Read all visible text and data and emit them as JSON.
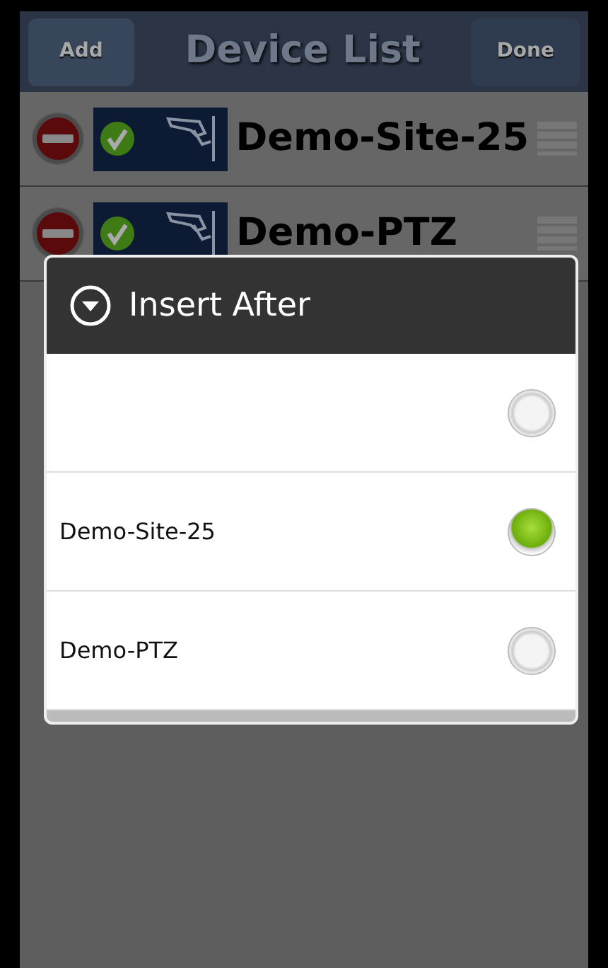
{
  "header": {
    "add_button": "Add",
    "title": "Device List",
    "done_button": "Done"
  },
  "devices": [
    {
      "name": "Demo-Site-25"
    },
    {
      "name": "Demo-PTZ"
    }
  ],
  "dialog": {
    "title": "Insert After",
    "options": [
      {
        "selected": false
      },
      {
        "label": "Demo-Site-25",
        "selected": true
      },
      {
        "label": "Demo-PTZ",
        "selected": false
      }
    ]
  }
}
